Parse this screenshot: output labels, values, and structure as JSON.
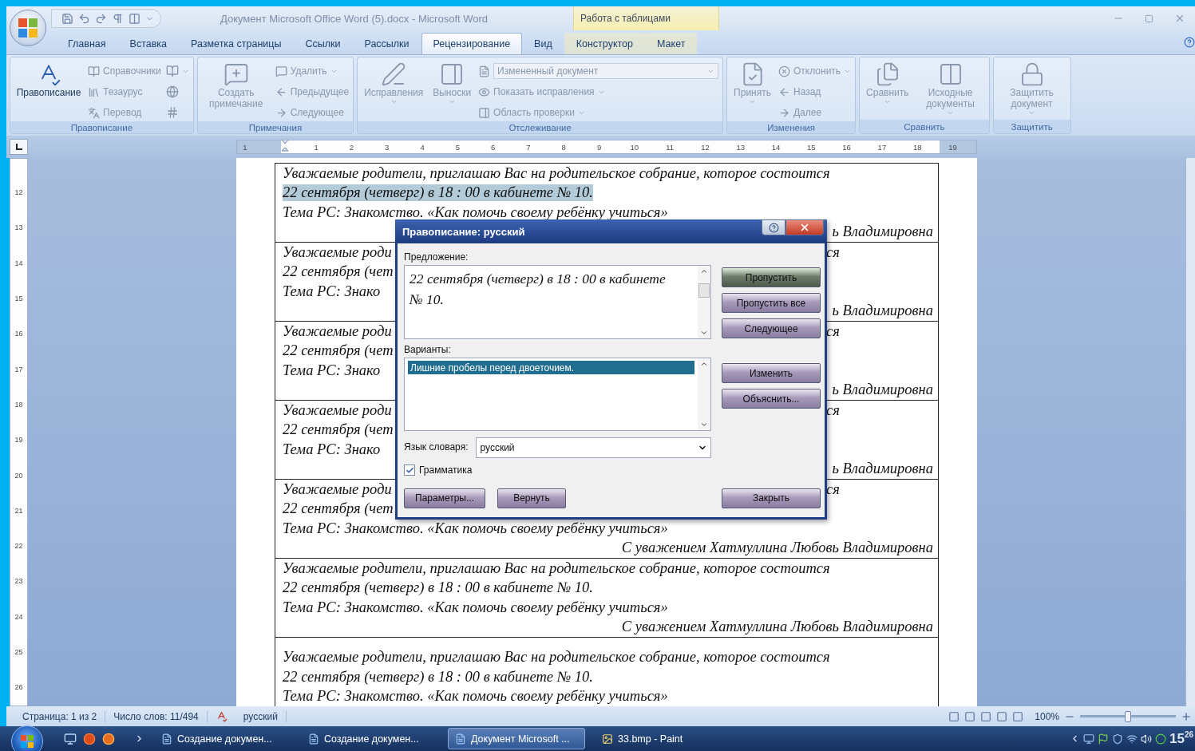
{
  "window": {
    "title": "Документ Microsoft Office Word (5).docx - Microsoft Word",
    "context_group": "Работа с таблицами"
  },
  "tabs": [
    {
      "label": "Главная",
      "selected": false,
      "contextual": false
    },
    {
      "label": "Вставка",
      "selected": false,
      "contextual": false
    },
    {
      "label": "Разметка страницы",
      "selected": false,
      "contextual": false
    },
    {
      "label": "Ссылки",
      "selected": false,
      "contextual": false
    },
    {
      "label": "Рассылки",
      "selected": false,
      "contextual": false
    },
    {
      "label": "Рецензирование",
      "selected": true,
      "contextual": false
    },
    {
      "label": "Вид",
      "selected": false,
      "contextual": false
    },
    {
      "label": "Конструктор",
      "selected": false,
      "contextual": true
    },
    {
      "label": "Макет",
      "selected": false,
      "contextual": true
    }
  ],
  "ribbon": {
    "groups": [
      {
        "label": "Правописание",
        "columns": [
          {
            "kind": "large",
            "label": "Правописание",
            "disabled": false,
            "dropdown": false
          },
          {
            "kind": "stack",
            "items": [
              {
                "kind": "small",
                "label": "Справочники",
                "disabled": true,
                "dropdown": false
              },
              {
                "kind": "small",
                "label": "Тезаурус",
                "disabled": true,
                "dropdown": false
              },
              {
                "kind": "small",
                "label": "Перевод",
                "disabled": true,
                "dropdown": false
              }
            ]
          },
          {
            "kind": "stack",
            "items": [
              {
                "kind": "icon",
                "disabled": true,
                "dropdown": true
              },
              {
                "kind": "icon",
                "disabled": true,
                "dropdown": false
              },
              {
                "kind": "icon",
                "disabled": true,
                "dropdown": false
              }
            ]
          }
        ]
      },
      {
        "label": "Примечания",
        "columns": [
          {
            "kind": "large",
            "label": "Создать примечание",
            "disabled": true,
            "dropdown": false
          },
          {
            "kind": "stack",
            "items": [
              {
                "kind": "small",
                "label": "Удалить",
                "disabled": true,
                "dropdown": true
              },
              {
                "kind": "small",
                "label": "Предыдущее",
                "disabled": true,
                "dropdown": false
              },
              {
                "kind": "small",
                "label": "Следующее",
                "disabled": true,
                "dropdown": false
              }
            ]
          }
        ]
      },
      {
        "label": "Отслеживание",
        "columns": [
          {
            "kind": "large",
            "label": "Исправления",
            "disabled": true,
            "dropdown": true
          },
          {
            "kind": "large",
            "label": "Выноски",
            "disabled": true,
            "dropdown": true
          },
          {
            "kind": "stack",
            "items": [
              {
                "kind": "field",
                "label": "Измененный документ",
                "disabled": true,
                "dropdown": true
              },
              {
                "kind": "small",
                "label": "Показать исправления",
                "disabled": true,
                "dropdown": true
              },
              {
                "kind": "small",
                "label": "Область проверки",
                "disabled": true,
                "dropdown": true
              }
            ]
          }
        ]
      },
      {
        "label": "Изменения",
        "columns": [
          {
            "kind": "large",
            "label": "Принять",
            "disabled": true,
            "dropdown": true
          },
          {
            "kind": "stack",
            "items": [
              {
                "kind": "small",
                "label": "Отклонить",
                "disabled": true,
                "dropdown": true
              },
              {
                "kind": "small",
                "label": "Назад",
                "disabled": true,
                "dropdown": false
              },
              {
                "kind": "small",
                "label": "Далее",
                "disabled": true,
                "dropdown": false
              }
            ]
          }
        ]
      },
      {
        "label": "Сравнить",
        "columns": [
          {
            "kind": "large",
            "label": "Сравнить",
            "disabled": true,
            "dropdown": true
          },
          {
            "kind": "large",
            "label": "Исходные документы",
            "disabled": true,
            "dropdown": true
          }
        ]
      },
      {
        "label": "Защитить",
        "columns": [
          {
            "kind": "large",
            "label": "Защитить документ",
            "disabled": true,
            "dropdown": true
          }
        ]
      }
    ]
  },
  "rulers": {
    "horizontal": [
      "1",
      "1",
      "2",
      "3",
      "4",
      "5",
      "6",
      "7",
      "8",
      "9",
      "10",
      "11",
      "12",
      "13",
      "14",
      "15",
      "16",
      "17",
      "18",
      "19"
    ],
    "vertical": [
      "12",
      "13",
      "14",
      "15",
      "16",
      "17",
      "18",
      "19",
      "20",
      "21",
      "22",
      "23",
      "24",
      "25",
      "26"
    ]
  },
  "document": {
    "rows": [
      {
        "lines": [
          {
            "kind": "text",
            "text": "Уважаемые родители, приглашаю Вас на родительское собрание, которое состоится",
            "highlighted": false
          },
          {
            "kind": "text",
            "text": "22 сентября (четверг)  в 18 : 00 в кабинете № 10.",
            "highlighted": true
          },
          {
            "kind": "text",
            "text": "Тема РС: Знакомство. «Как помочь своему ребёнку учиться»",
            "highlighted": false
          },
          {
            "kind": "signature",
            "text": "ь Владимировна",
            "highlighted": false
          }
        ]
      },
      {
        "lines": [
          {
            "kind": "split",
            "text": "Уважаемые роди",
            "tail": "ся",
            "highlighted": false
          },
          {
            "kind": "text",
            "text": "22 сентября (чет",
            "highlighted": false
          },
          {
            "kind": "text",
            "text": "Тема РС: Знако",
            "highlighted": false
          },
          {
            "kind": "signature",
            "text": "ь Владимировна",
            "highlighted": false
          }
        ]
      },
      {
        "lines": [
          {
            "kind": "split",
            "text": "Уважаемые роди",
            "tail": "ся",
            "highlighted": false
          },
          {
            "kind": "text",
            "text": "22 сентября (чет",
            "highlighted": false
          },
          {
            "kind": "text",
            "text": "Тема РС: Знако",
            "highlighted": false
          },
          {
            "kind": "signature",
            "text": "ь Владимировна",
            "highlighted": false
          }
        ]
      },
      {
        "lines": [
          {
            "kind": "split",
            "text": "Уважаемые роди",
            "tail": "ся",
            "highlighted": false
          },
          {
            "kind": "text",
            "text": "22 сентября (чет",
            "highlighted": false
          },
          {
            "kind": "text",
            "text": "Тема РС: Знако",
            "highlighted": false
          },
          {
            "kind": "signature",
            "text": "ь Владимировна",
            "highlighted": false
          }
        ]
      },
      {
        "lines": [
          {
            "kind": "split",
            "text": "Уважаемые роди",
            "tail": "ся",
            "highlighted": false
          },
          {
            "kind": "text",
            "text": "22 сентября (чет",
            "highlighted": false
          },
          {
            "kind": "text",
            "text": "Тема РС: Знакомство. «Как помочь своему ребёнку учиться»",
            "highlighted": false
          },
          {
            "kind": "signature",
            "text": "С уважением Хатмуллина Любовь Владимировна",
            "highlighted": false
          }
        ]
      },
      {
        "lines": [
          {
            "kind": "text",
            "text": "Уважаемые родители, приглашаю Вас на родительское собрание, которое состоится",
            "highlighted": false
          },
          {
            "kind": "text",
            "text": "22 сентября (четверг)  в 18 : 00 в кабинете № 10.",
            "highlighted": false
          },
          {
            "kind": "text",
            "text": "Тема РС: Знакомство. «Как помочь своему ребёнку учиться»",
            "highlighted": false
          },
          {
            "kind": "signature",
            "text": "С уважением Хатмуллина Любовь Владимировна",
            "highlighted": false
          }
        ]
      },
      {
        "lines": [
          {
            "kind": "text",
            "text": "Уважаемые родители, приглашаю Вас на родительское собрание, которое состоится",
            "highlighted": false
          },
          {
            "kind": "text",
            "text": "22 сентября (четверг)  в 18 : 00 в кабинете № 10.",
            "highlighted": false
          },
          {
            "kind": "text",
            "text": "Тема РС: Знакомство. «Как помочь своему ребёнку учиться»",
            "highlighted": false
          }
        ]
      }
    ]
  },
  "dialog": {
    "title": "Правописание: русский",
    "sentence_label": "Предложение:",
    "sentence": "22 сентября (четверг)  в 18 : 00 в кабинете № 10.",
    "suggestions_label": "Варианты:",
    "suggestions": [
      {
        "label": "Лишние пробелы перед двоеточием.",
        "selected": true
      }
    ],
    "language_label": "Язык словаря:",
    "language": "русский",
    "grammar": {
      "label": "Грамматика",
      "checked": true
    },
    "side_buttons": [
      [
        {
          "label": "Пропустить",
          "default": true
        },
        {
          "label": "Пропустить все",
          "default": false
        },
        {
          "label": "Следующее",
          "default": false
        }
      ],
      [
        {
          "label": "Изменить",
          "default": false
        },
        {
          "label": "Объяснить...",
          "default": false
        }
      ]
    ],
    "bottom_buttons": [
      {
        "label": "Параметры...",
        "default": false
      },
      {
        "label": "Вернуть",
        "default": false
      }
    ],
    "close_button": {
      "label": "Закрыть",
      "default": false
    }
  },
  "status_bar": {
    "page": "Страница: 1 из 2",
    "words": "Число слов: 11/494",
    "language": "русский",
    "zoom": "100%",
    "zoom_slider": {
      "level": 0.5
    }
  },
  "taskbar": {
    "tasks": [
      {
        "label": "Создание докумен...",
        "selected": false
      },
      {
        "label": "Создание докумен...",
        "selected": false
      },
      {
        "label": "Документ Microsoft ...",
        "selected": true
      },
      {
        "label": "33.bmp - Paint",
        "selected": false
      }
    ],
    "clock": "15$^{26}$"
  }
}
